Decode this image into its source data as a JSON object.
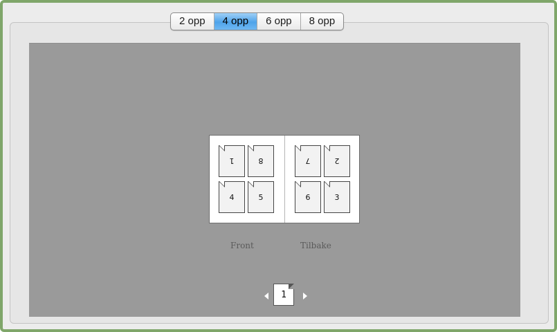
{
  "segmented": {
    "options": [
      "2 opp",
      "4 opp",
      "6 opp",
      "8 opp"
    ],
    "selected_index": 1
  },
  "preview": {
    "front_pages": {
      "top": [
        "1",
        "8"
      ],
      "bottom": [
        "4",
        "5"
      ]
    },
    "back_pages": {
      "top": [
        "7",
        "2"
      ],
      "bottom": [
        "6",
        "3"
      ]
    },
    "front_label": "Front",
    "back_label": "Tilbake"
  },
  "navigator": {
    "current_page": "1"
  },
  "colors": {
    "frame_border": "#7fa66a",
    "preview_bg": "#9a9a9a",
    "selected_segment": "#4fa3ea"
  }
}
